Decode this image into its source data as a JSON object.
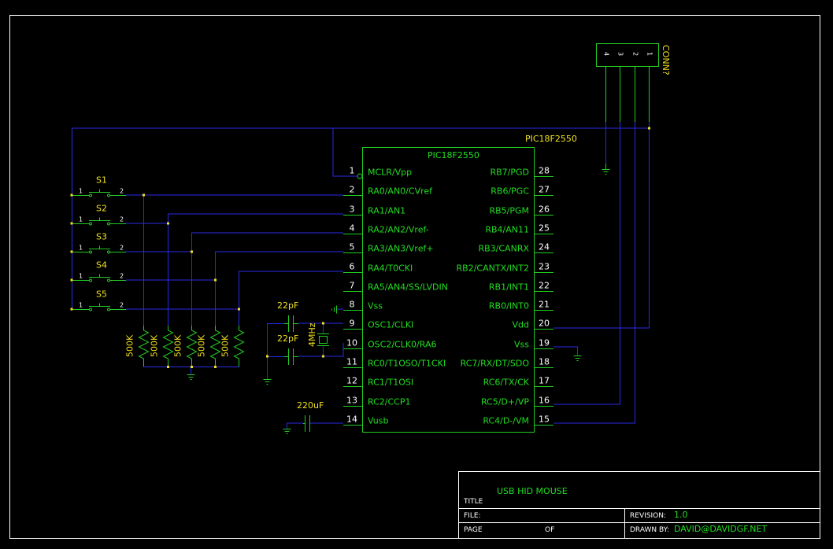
{
  "chip": {
    "name": "PIC18F2550",
    "ref": "PIC18F2550",
    "left_pins": [
      {
        "num": "1",
        "name": "MCLR/Vpp"
      },
      {
        "num": "2",
        "name": "RA0/AN0/CVref"
      },
      {
        "num": "3",
        "name": "RA1/AN1"
      },
      {
        "num": "4",
        "name": "RA2/AN2/Vref-"
      },
      {
        "num": "5",
        "name": "RA3/AN3/Vref+"
      },
      {
        "num": "6",
        "name": "RA4/T0CKI"
      },
      {
        "num": "7",
        "name": "RA5/AN4/SS/LVDIN"
      },
      {
        "num": "8",
        "name": "Vss"
      },
      {
        "num": "9",
        "name": "OSC1/CLKI"
      },
      {
        "num": "10",
        "name": "OSC2/CLK0/RA6"
      },
      {
        "num": "11",
        "name": "RC0/T1OSO/T1CKI"
      },
      {
        "num": "12",
        "name": "RC1/T1OSI"
      },
      {
        "num": "13",
        "name": "RC2/CCP1"
      },
      {
        "num": "14",
        "name": "Vusb"
      }
    ],
    "right_pins": [
      {
        "num": "28",
        "name": "RB7/PGD"
      },
      {
        "num": "27",
        "name": "RB6/PGC"
      },
      {
        "num": "26",
        "name": "RB5/PGM"
      },
      {
        "num": "25",
        "name": "RB4/AN11"
      },
      {
        "num": "24",
        "name": "RB3/CANRX"
      },
      {
        "num": "23",
        "name": "RB2/CANTX/INT2"
      },
      {
        "num": "22",
        "name": "RB1/INT1"
      },
      {
        "num": "21",
        "name": "RB0/INT0"
      },
      {
        "num": "20",
        "name": "Vdd"
      },
      {
        "num": "19",
        "name": "Vss"
      },
      {
        "num": "18",
        "name": "RC7/RX/DT/SDO"
      },
      {
        "num": "17",
        "name": "RC6/TX/CK"
      },
      {
        "num": "16",
        "name": "RC5/D+/VP"
      },
      {
        "num": "15",
        "name": "RC4/D-/VM"
      }
    ]
  },
  "connector": {
    "ref": "CONN?",
    "pins": [
      "4",
      "3",
      "2",
      "1"
    ]
  },
  "switches": [
    {
      "ref": "S1",
      "pin1": "1",
      "pin2": "2"
    },
    {
      "ref": "S2",
      "pin1": "1",
      "pin2": "2"
    },
    {
      "ref": "S3",
      "pin1": "1",
      "pin2": "2"
    },
    {
      "ref": "S4",
      "pin1": "1",
      "pin2": "2"
    },
    {
      "ref": "S5",
      "pin1": "1",
      "pin2": "2"
    }
  ],
  "resistors": [
    "500K",
    "500K",
    "500K",
    "500K",
    "500K"
  ],
  "capacitors": {
    "osc1": "22pF",
    "osc2": "22pF",
    "vusb": "220uF"
  },
  "crystal": "4MHz",
  "title_block": {
    "title_label": "TITLE",
    "title_value": "USB HID MOUSE",
    "file_label": "FILE:",
    "page_label": "PAGE",
    "of_label": "OF",
    "revision_label": "REVISION:",
    "revision_value": "1.0",
    "drawn_by_label": "DRAWN BY:",
    "drawn_by_value": "DAVID@DAVIDGF.NET"
  },
  "colors": {
    "background": "#000000",
    "wire": "#2a2ae6",
    "component": "#22cc22",
    "label": "#f0e020",
    "frame": "#ffffff"
  }
}
